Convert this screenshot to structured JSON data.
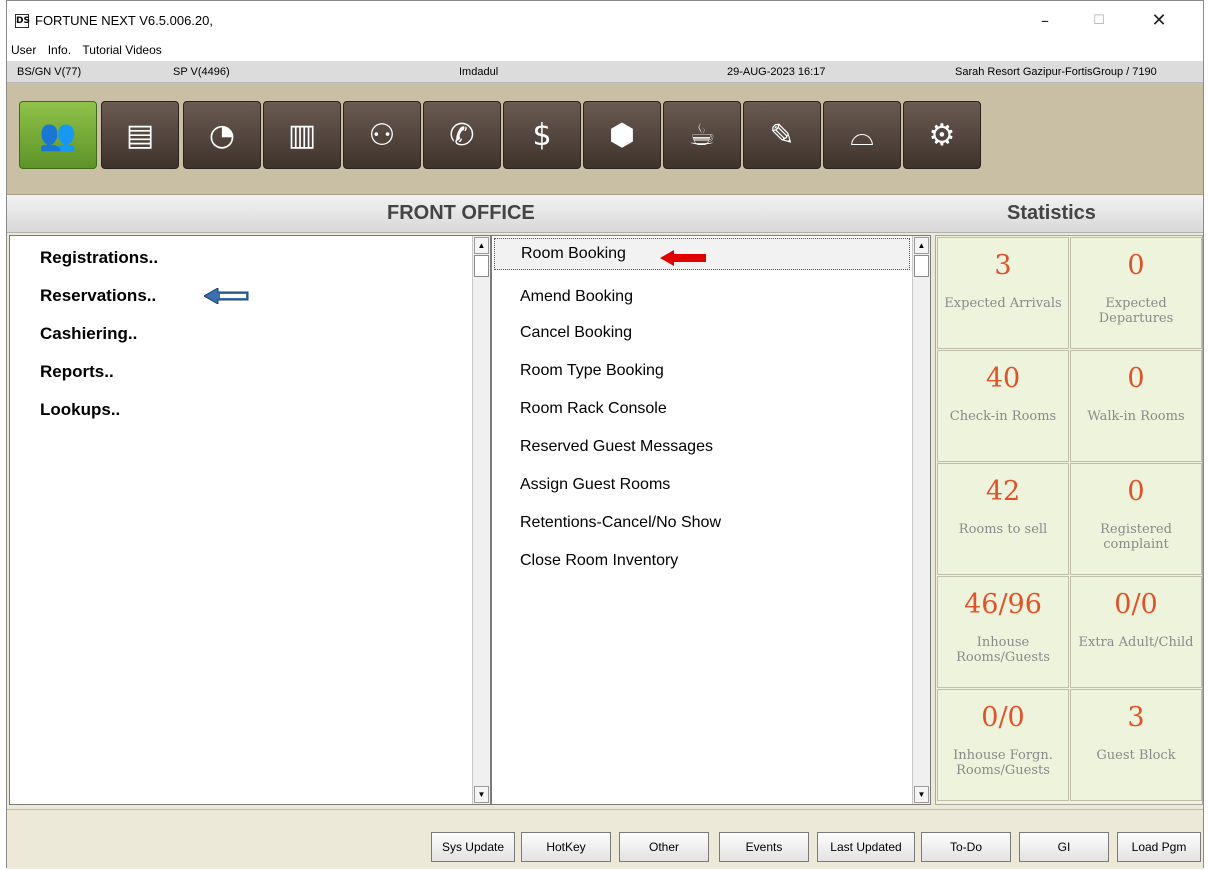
{
  "window": {
    "title": "FORTUNE NEXT  V6.5.006.20,",
    "icon_glyph": "DS",
    "minimize": "–",
    "maximize": "☐",
    "close": "✕"
  },
  "menu": [
    "User",
    "Info.",
    "Tutorial Videos"
  ],
  "infobar": {
    "bs": "BS/GN V(77)",
    "sp": "SP V(4496)",
    "user": "Imdadul",
    "datetime": "29-AUG-2023 16:17",
    "property": "Sarah Resort Gazipur-FortisGroup / 7190"
  },
  "toolbar": {
    "buttons": [
      {
        "icon": "front-office-icon",
        "glyph": "👥",
        "active": true
      },
      {
        "icon": "cashier-register-icon",
        "glyph": "▤"
      },
      {
        "icon": "night-audit-clock-icon",
        "glyph": "◔"
      },
      {
        "icon": "buildings-icon",
        "glyph": "▥"
      },
      {
        "icon": "conference-icon",
        "glyph": "⚇"
      },
      {
        "icon": "telephone-icon",
        "glyph": "✆"
      },
      {
        "icon": "money-bag-icon",
        "glyph": "$"
      },
      {
        "icon": "package-box-icon",
        "glyph": "⬢"
      },
      {
        "icon": "food-beverage-icon",
        "glyph": "☕"
      },
      {
        "icon": "edit-document-icon",
        "glyph": "✎"
      },
      {
        "icon": "housekeeping-hat-icon",
        "glyph": "⌓"
      },
      {
        "icon": "settings-gears-icon",
        "glyph": "⚙"
      }
    ]
  },
  "header": {
    "front_office": "FRONT OFFICE",
    "statistics": "Statistics"
  },
  "left_menu": [
    "Registrations..",
    "Reservations..",
    "Cashiering..",
    "Reports..",
    "Lookups.."
  ],
  "mid_menu": [
    "Room Booking",
    "Amend Booking",
    "Cancel Booking",
    "Room Type Booking",
    "Room Rack Console",
    "Reserved Guest  Messages",
    "Assign Guest Rooms",
    "Retentions-Cancel/No Show",
    "Close Room Inventory"
  ],
  "stats": [
    {
      "value": "3",
      "label": "Expected Arrivals"
    },
    {
      "value": "0",
      "label": "Expected Departures"
    },
    {
      "value": "40",
      "label": "Check-in Rooms"
    },
    {
      "value": "0",
      "label": "Walk-in Rooms"
    },
    {
      "value": "42",
      "label": "Rooms to sell"
    },
    {
      "value": "0",
      "label": "Registered complaint"
    },
    {
      "value": "46/96",
      "label": "Inhouse Rooms/Guests"
    },
    {
      "value": "0/0",
      "label": "Extra Adult/Child"
    },
    {
      "value": "0/0",
      "label": "Inhouse Forgn. Rooms/Guests"
    },
    {
      "value": "3",
      "label": "Guest Block"
    }
  ],
  "bottom_buttons": [
    "Sys Update",
    "HotKey",
    "Other",
    "Events",
    "Last Updated",
    "To-Do",
    "GI",
    "Load Pgm"
  ],
  "colors": {
    "accent_green": "#6fa833",
    "stat_value": "#e0532a",
    "stat_bg": "#eef3dc",
    "toolbar_bg": "#c8bfa5",
    "arrow_red": "#e00000",
    "arrow_blue": "#3a6fb0"
  }
}
